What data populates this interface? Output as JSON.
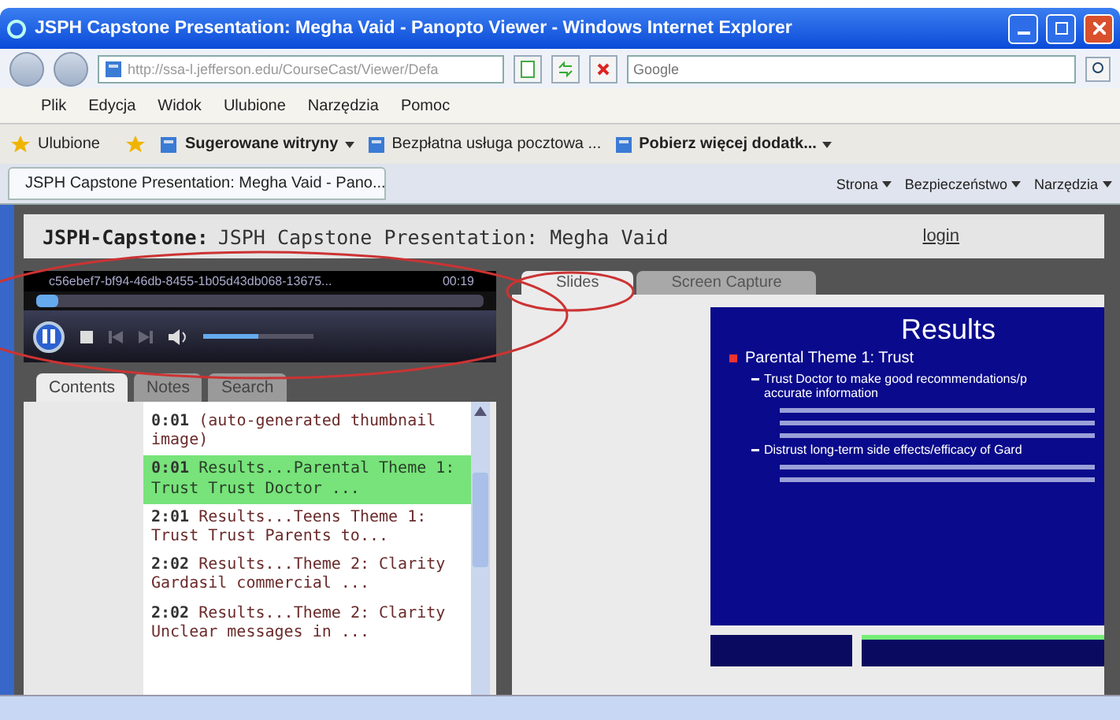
{
  "window": {
    "title": "JSPH Capstone Presentation: Megha Vaid - Panopto Viewer - Windows Internet Explorer"
  },
  "address_bar": {
    "value": "http://ssa-l.jefferson.edu/CourseCast/Viewer/Defa"
  },
  "search": {
    "placeholder": "Google"
  },
  "menu": [
    "Plik",
    "Edycja",
    "Widok",
    "Ulubione",
    "Narzędzia",
    "Pomoc"
  ],
  "favorites_bar": [
    {
      "label": "Ulubione",
      "kind": "favorites"
    },
    {
      "label": "Sugerowane witryny",
      "kind": "dropdown"
    },
    {
      "label": "Bezpłatna usługa pocztowa ...",
      "kind": "link"
    },
    {
      "label": "Pobierz więcej dodatk...",
      "kind": "dropdown"
    }
  ],
  "browser_tab": {
    "label": "JSPH Capstone Presentation: Megha Vaid - Pano..."
  },
  "command_bar": [
    "Strona",
    "Bezpieczeństwo",
    "Narzędzia"
  ],
  "page_header": {
    "prefix": "JSPH-Capstone:",
    "title": "JSPH Capstone Presentation: Megha Vaid",
    "login": "login"
  },
  "player": {
    "media_id": "c56ebef7-bf94-46db-8455-1b05d43db068-13675...",
    "time": "00:19",
    "progress": {
      "level": 0.05
    },
    "volume": {
      "level": 0.5
    }
  },
  "left_tabs": [
    {
      "label": "Contents",
      "selected": true
    },
    {
      "label": "Notes",
      "selected": false
    },
    {
      "label": "Search",
      "selected": false
    }
  ],
  "contents": [
    {
      "time": "0:01",
      "text": "(auto-generated thumbnail image)",
      "selected": false
    },
    {
      "time": "0:01",
      "text": "Results...Parental Theme 1: Trust Trust Doctor ...",
      "selected": true
    },
    {
      "time": "2:01",
      "text": "Results...Teens Theme 1: Trust Trust Parents to...",
      "selected": false
    },
    {
      "time": "2:02",
      "text": "Results...Theme 2: Clarity Gardasil commercial ...",
      "selected": false
    },
    {
      "time": "2:02",
      "text": "Results...Theme 2: Clarity Unclear messages in ...",
      "selected": false
    }
  ],
  "right_tabs": [
    {
      "label": "Slides",
      "selected": true
    },
    {
      "label": "Screen Capture",
      "selected": false
    }
  ],
  "slide": {
    "title": "Results",
    "bullets": [
      {
        "text": "Parental Theme 1: Trust",
        "kind": "main"
      },
      {
        "text": "Trust Doctor to make good recommendations/p",
        "kind": "sub"
      },
      {
        "text": "accurate information",
        "kind": "cont"
      },
      {
        "kind": "quote"
      },
      {
        "kind": "quote"
      },
      {
        "kind": "quote"
      },
      {
        "text": "Distrust long-term side effects/efficacy of Gard",
        "kind": "sub"
      },
      {
        "kind": "quote"
      },
      {
        "kind": "quote"
      }
    ]
  }
}
